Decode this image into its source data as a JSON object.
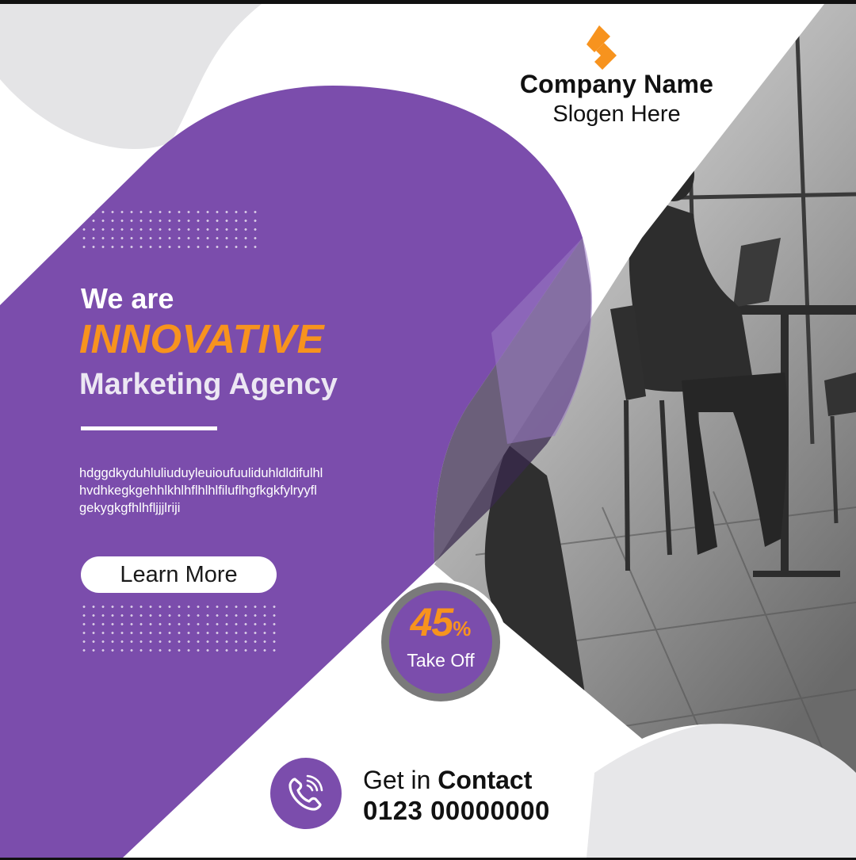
{
  "brand": {
    "company_name": "Company Name",
    "slogan": "Slogen Here",
    "logo_icon": "chevron-logo-icon"
  },
  "hero": {
    "line1": "We are",
    "highlight": "INNOVATIVE",
    "line3": "Marketing Agency",
    "body_lines": [
      "hdggdkyduhluliuduyleuioufuuliduhldldifulhl",
      "hvdhkegkgehhlkhlhflhlhlfiluflhgfkgkfylryyfl",
      "gekygkgfhlhfljjjlriji"
    ],
    "cta_label": "Learn More"
  },
  "offer": {
    "value": "45",
    "unit": "%",
    "label": "Take Off"
  },
  "contact": {
    "prefix": "Get in",
    "emphasis": "Contact",
    "phone": "0123 00000000",
    "icon": "phone-icon"
  },
  "colors": {
    "purple": "#7b4dac",
    "orange": "#f7931e",
    "light_gray": "#e4e4e6",
    "text_dark": "#111111"
  }
}
